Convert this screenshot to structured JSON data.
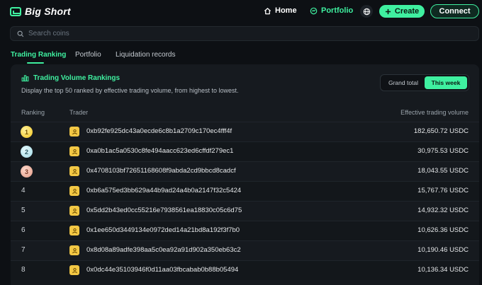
{
  "app": {
    "name": "Big Short"
  },
  "nav": {
    "home": "Home",
    "portfolio": "Portfolio",
    "create": "Create",
    "connect": "Connect"
  },
  "search": {
    "placeholder": "Search coins"
  },
  "tabs": [
    {
      "label": "Trading Ranking",
      "active": true
    },
    {
      "label": "Portfolio",
      "active": false
    },
    {
      "label": "Liquidation records",
      "active": false
    }
  ],
  "card": {
    "title": "Trading Volume Rankings",
    "description": "Display the top 50 ranked by effective trading volume, from highest to lowest.",
    "toggle": {
      "grand_total": "Grand total",
      "this_week": "This week",
      "selected": "This week"
    }
  },
  "table": {
    "headers": {
      "ranking": "Ranking",
      "trader": "Trader",
      "volume": "Effective trading volume"
    },
    "rows": [
      {
        "rank": "1",
        "medal": "gold",
        "address": "0xb92fe925dc43a0ecde6c8b1a2709c170ec4fff4f",
        "volume": "182,650.72 USDC"
      },
      {
        "rank": "2",
        "medal": "silver",
        "address": "0xa0b1ac5a0530c8fe494aacc623ed6cffdf279ec1",
        "volume": "30,975.53 USDC"
      },
      {
        "rank": "3",
        "medal": "bronze",
        "address": "0x4708103bf72651168608f9abda2cd9bbcd8cadcf",
        "volume": "18,043.55 USDC"
      },
      {
        "rank": "4",
        "medal": "",
        "address": "0xb6a575ed3bb629a44b9ad24a4b0a2147f32c5424",
        "volume": "15,767.76 USDC"
      },
      {
        "rank": "5",
        "medal": "",
        "address": "0x5dd2b43ed0cc55216e7938561ea18830c05c6d75",
        "volume": "14,932.32 USDC"
      },
      {
        "rank": "6",
        "medal": "",
        "address": "0x1ee650d3449134e0972ded14a21bd8a192f3f7b0",
        "volume": "10,626.36 USDC"
      },
      {
        "rank": "7",
        "medal": "",
        "address": "0x8d08a89adfe398aa5c0ea92a91d902a350eb63c2",
        "volume": "10,190.46 USDC"
      },
      {
        "rank": "8",
        "medal": "",
        "address": "0x0dc44e35103946f0d11aa03fbcabab0b88b05494",
        "volume": "10,136.34 USDC"
      }
    ]
  },
  "colors": {
    "accent": "#3ff0a0",
    "background": "#0d1014",
    "card": "#161a1f",
    "avatar": "#f2c744"
  },
  "icons": {
    "logo": "chart-box-icon",
    "home": "home-icon",
    "portfolio": "pie-chart-icon",
    "language": "globe-icon",
    "create": "plus-icon",
    "search": "search-icon",
    "card_title": "bar-chart-icon",
    "avatar": "user-icon"
  }
}
